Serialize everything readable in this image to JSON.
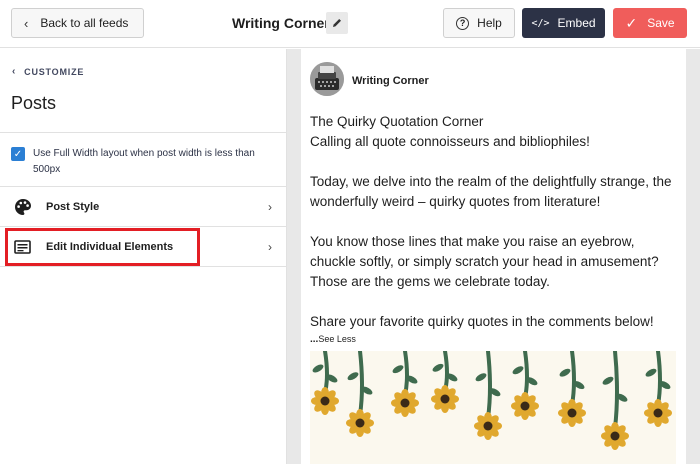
{
  "topbar": {
    "back_label": "Back to all feeds",
    "feed_title": "Writing Corner",
    "help_label": "Help",
    "embed_label": "Embed",
    "save_label": "Save",
    "save_color": "#f05d5b",
    "embed_color": "#2c3246"
  },
  "sidebar": {
    "breadcrumb": "CUSTOMIZE",
    "title": "Posts",
    "full_width_option": {
      "label": "Use Full Width layout when post width is less than 500px",
      "checked": true
    },
    "items": [
      {
        "label": "Post Style",
        "icon": "palette-icon"
      },
      {
        "label": "Edit Individual Elements",
        "icon": "text-block-icon",
        "highlighted": true
      }
    ],
    "highlight_color": "#e31e24"
  },
  "preview": {
    "author": "Writing Corner",
    "avatar_icon": "typewriter-icon",
    "paragraphs": [
      [
        "The Quirky Quotation Corner",
        "Calling all quote connoisseurs and bibliophiles!"
      ],
      [
        "Today, we delve into the realm of the delightfully strange, the wonderfully weird – quirky quotes from literature!"
      ],
      [
        "You know those lines that make you raise an eyebrow, chuckle softly, or simply scratch your head in amusement? Those are the gems we celebrate today."
      ],
      [
        "Share your favorite quirky quotes in the comments below!"
      ]
    ],
    "see_less_prefix": "...",
    "see_less_label": "See Less",
    "image_icon": "hanging-flowers-illustration"
  }
}
